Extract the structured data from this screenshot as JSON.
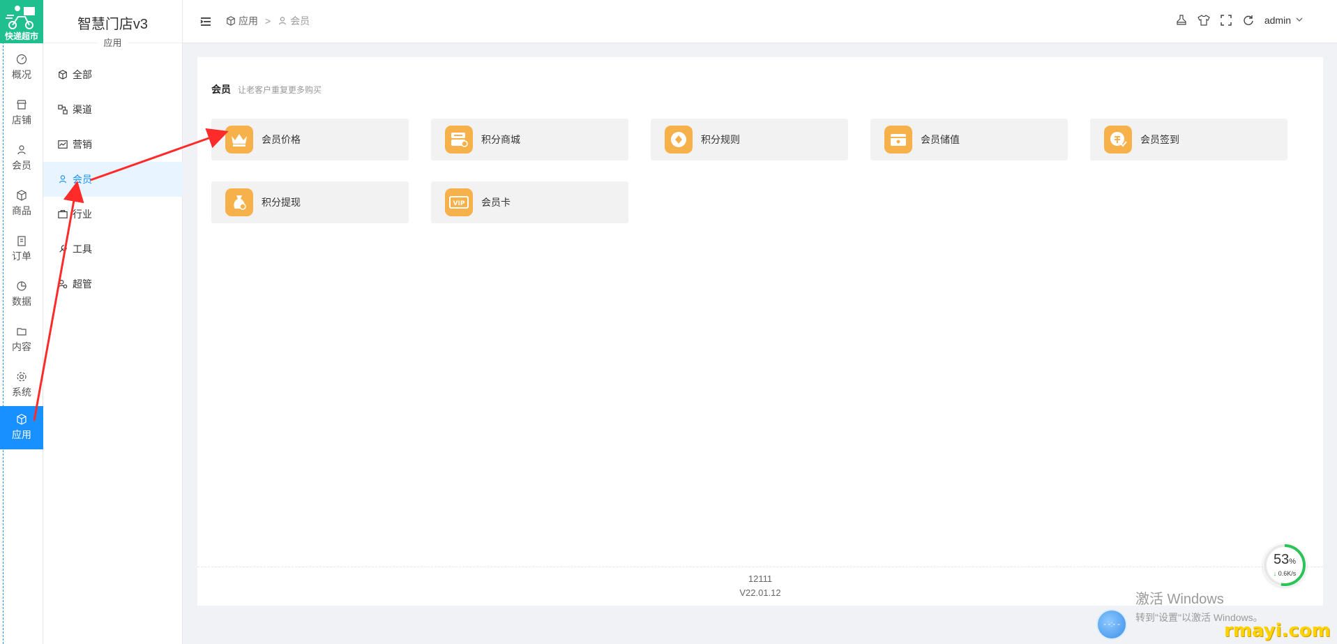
{
  "logo": {
    "text": "快递超市"
  },
  "rail": {
    "items": [
      {
        "label": "概况",
        "icon": "dashboard-icon"
      },
      {
        "label": "店铺",
        "icon": "store-icon"
      },
      {
        "label": "会员",
        "icon": "user-icon"
      },
      {
        "label": "商品",
        "icon": "box-icon"
      },
      {
        "label": "订单",
        "icon": "clipboard-icon"
      },
      {
        "label": "数据",
        "icon": "pie-chart-icon"
      },
      {
        "label": "内容",
        "icon": "folder-icon"
      },
      {
        "label": "系统",
        "icon": "gear-icon"
      },
      {
        "label": "应用",
        "icon": "cube-icon",
        "active": true
      }
    ]
  },
  "brand": {
    "title": "智慧门店v3",
    "subtitle": "应用"
  },
  "subnav": {
    "items": [
      {
        "label": "全部",
        "icon": "cube-icon"
      },
      {
        "label": "渠道",
        "icon": "channel-icon"
      },
      {
        "label": "营销",
        "icon": "trend-icon"
      },
      {
        "label": "会员",
        "icon": "user-icon",
        "active": true
      },
      {
        "label": "行业",
        "icon": "briefcase-icon"
      },
      {
        "label": "工具",
        "icon": "tool-icon"
      },
      {
        "label": "超管",
        "icon": "admin-icon"
      }
    ]
  },
  "breadcrumb": {
    "root": "应用",
    "separator": ">",
    "current": "会员"
  },
  "header": {
    "username": "admin"
  },
  "section": {
    "title": "会员",
    "description": "让老客户重复更多购买"
  },
  "apps": [
    {
      "label": "会员价格",
      "icon": "crown-icon"
    },
    {
      "label": "积分商城",
      "icon": "mall-icon"
    },
    {
      "label": "积分规则",
      "icon": "rule-coin-icon"
    },
    {
      "label": "会员储值",
      "icon": "wallet-icon"
    },
    {
      "label": "会员签到",
      "icon": "checkin-icon"
    },
    {
      "label": "积分提现",
      "icon": "money-bag-icon"
    },
    {
      "label": "会员卡",
      "icon": "vip-card-icon"
    }
  ],
  "footer": {
    "line1": "12111",
    "version": "V22.01.12"
  },
  "speed_widget": {
    "percent": "53",
    "percent_unit": "%",
    "rate": "0.6K/s",
    "rate_arrow": "↓"
  },
  "windows_watermark": {
    "title": "激活 Windows",
    "hint": "转到\"设置\"以激活 Windows。"
  },
  "site_watermark": "rmayi.com",
  "colors": {
    "accent": "#1890ff",
    "app_icon_bg": "#f7b14a",
    "logo_bg": "#1fbf8f",
    "arrow": "#ff2a2a"
  }
}
